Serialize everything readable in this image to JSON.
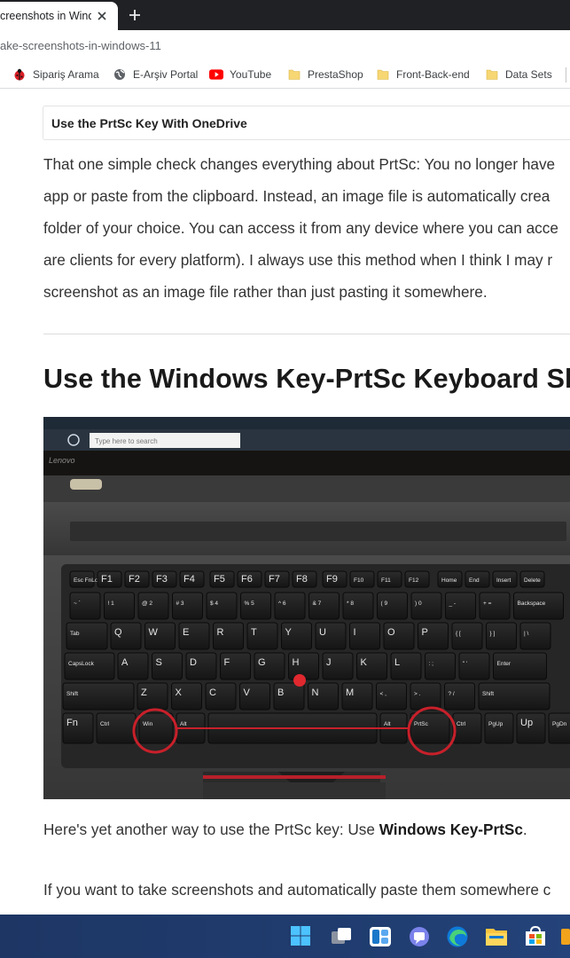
{
  "browser": {
    "tab_title": "creenshots in Wind",
    "url": "ake-screenshots-in-windows-11",
    "bookmarks": [
      {
        "label": "Sipariş Arama",
        "icon": "ladybug-icon"
      },
      {
        "label": "E-Arşiv Portal",
        "icon": "globe-icon"
      },
      {
        "label": "YouTube",
        "icon": "youtube-icon"
      },
      {
        "label": "PrestaShop",
        "icon": "folder-icon"
      },
      {
        "label": "Front-Back-end",
        "icon": "folder-icon"
      },
      {
        "label": "Data Sets",
        "icon": "folder-icon"
      }
    ]
  },
  "article": {
    "callout_title": "Use the PrtSc Key With OneDrive",
    "paragraph_lines": [
      "That one simple check changes everything about PrtSc: You no longer have",
      "app or paste from the clipboard. Instead, an image file is automatically crea",
      "folder of your choice. You can access it from any device where you can acce",
      "are clients for every platform). I always use this method when I think I may r",
      "screenshot as an image file rather than just pasting it somewhere."
    ],
    "heading": "Use the Windows Key-PrtSc Keyboard Sh",
    "after_photo_prefix": "Here's yet another way to use the PrtSc key: Use ",
    "after_photo_bold": "Windows Key-PrtSc",
    "after_photo_suffix": ".",
    "last_line": "If you want to take screenshots and automatically paste them somewhere c"
  },
  "photo": {
    "search_placeholder": "Type here to search",
    "brand": "Lenovo",
    "keys_row_fn": [
      "Esc FnLock",
      "F1",
      "F2",
      "F3",
      "F4",
      "F5",
      "F6",
      "F7",
      "F8",
      "F9",
      "F10",
      "F11",
      "F12",
      "Home",
      "End",
      "Insert",
      "Delete"
    ],
    "keys_row_num": [
      "~ `",
      "! 1",
      "@ 2",
      "# 3",
      "$ 4",
      "% 5",
      "^ 6",
      "& 7",
      "* 8",
      "( 9",
      ") 0",
      "_ -",
      "+ =",
      "Backspace"
    ],
    "keys_row_q": [
      "Tab",
      "Q",
      "W",
      "E",
      "R",
      "T",
      "Y",
      "U",
      "I",
      "O",
      "P",
      "{ [",
      "} ]",
      "| \\"
    ],
    "keys_row_a": [
      "CapsLock",
      "A",
      "S",
      "D",
      "F",
      "G",
      "H",
      "J",
      "K",
      "L",
      ": ;",
      "\" '",
      "Enter"
    ],
    "keys_row_z": [
      "Shift",
      "Z",
      "X",
      "C",
      "V",
      "B",
      "N",
      "M",
      "< ,",
      "> .",
      "? /",
      "Shift"
    ],
    "keys_row_bottom": [
      "Fn",
      "Ctrl",
      "Win",
      "Alt",
      "Space",
      "Alt",
      "PrtSc",
      "Ctrl",
      "PgUp",
      "Up",
      "PgDn"
    ],
    "highlight_color": "#c8202a"
  },
  "taskbar": {
    "icons": [
      "windows-start-icon",
      "task-view-icon",
      "widgets-icon",
      "teams-chat-icon",
      "edge-icon",
      "file-explorer-icon",
      "store-icon",
      "app-icon"
    ]
  }
}
